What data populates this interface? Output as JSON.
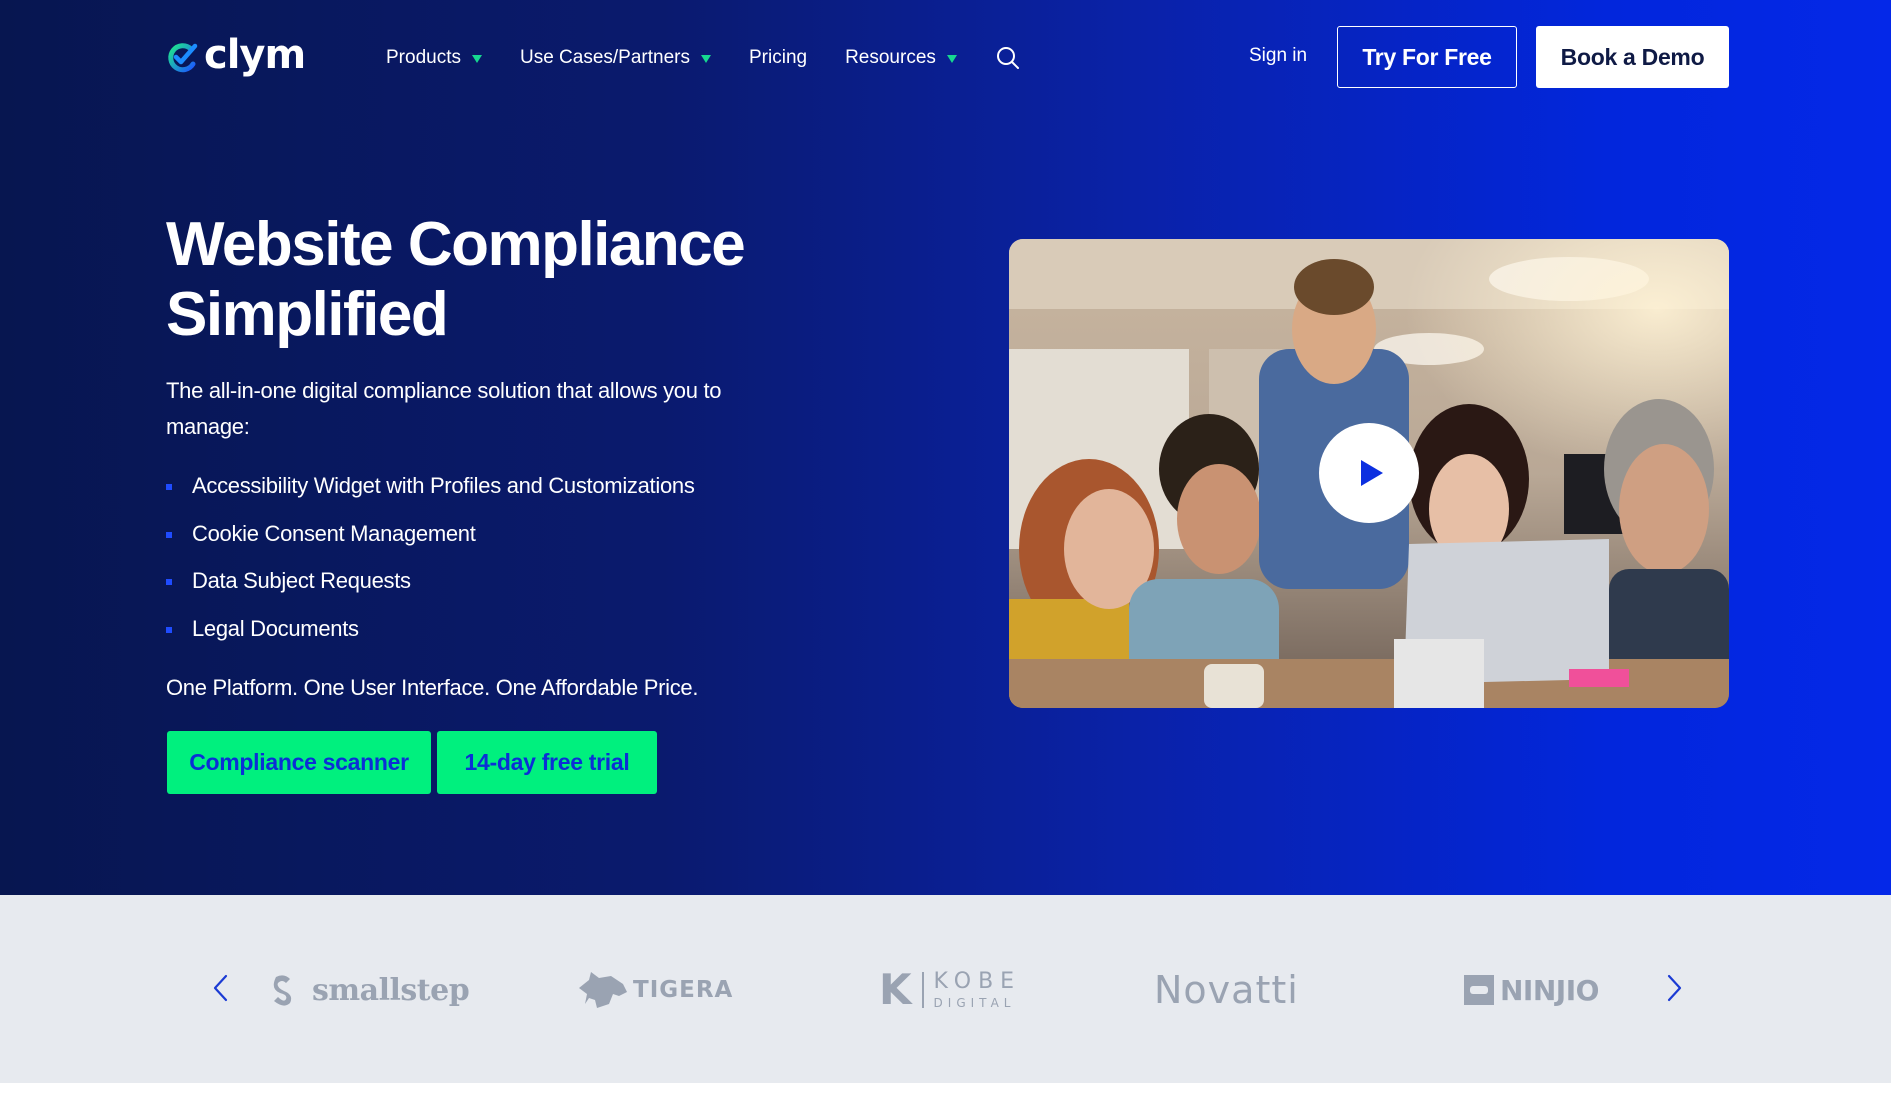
{
  "brand": {
    "name": "clym",
    "logo_icon": "check-circle-logo-icon"
  },
  "nav": {
    "items": [
      {
        "label": "Products",
        "has_dropdown": true
      },
      {
        "label": "Use Cases/Partners",
        "has_dropdown": true
      },
      {
        "label": "Pricing",
        "has_dropdown": false
      },
      {
        "label": "Resources",
        "has_dropdown": true
      }
    ],
    "search_icon": "search-icon",
    "signin_label": "Sign in",
    "try_free_label": "Try For Free",
    "book_demo_label": "Book a Demo"
  },
  "hero": {
    "title_line1": "Website Compliance",
    "title_line2": "Simplified",
    "subtitle": "The all-in-one digital compliance solution that allows you to manage:",
    "features": [
      "Accessibility Widget with Profiles and Customizations",
      "Cookie Consent Management",
      "Data Subject Requests",
      "Legal Documents"
    ],
    "tagline": "One Platform. One User Interface. One Affordable Price.",
    "cta_primary": "Compliance scanner",
    "cta_secondary": "14-day free trial",
    "video": {
      "description": "Team of five colleagues gathered around a laptop in an office",
      "play_icon": "play-icon"
    }
  },
  "partners": {
    "prev_icon": "chevron-left-icon",
    "next_icon": "chevron-right-icon",
    "logos": [
      {
        "name": "smallstep"
      },
      {
        "name": "TIGERA"
      },
      {
        "name": "KOBE",
        "sub": "DIGITAL"
      },
      {
        "name": "Novatti"
      },
      {
        "name": "NINJIO"
      }
    ]
  },
  "colors": {
    "hero_dark": "#071650",
    "hero_bright": "#0428e8",
    "accent_green": "#00f07e",
    "cta_text": "#0b2fd6",
    "caret_green": "#16d890",
    "strip_bg": "#e7eaef",
    "partner_gray": "#9aa3b2"
  }
}
